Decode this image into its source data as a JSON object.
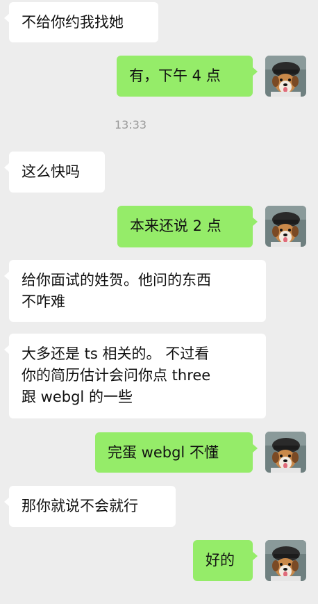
{
  "messages": [
    {
      "side": "left",
      "text": "不给你约我找她"
    },
    {
      "side": "right",
      "text": "有，下午 4 点"
    },
    {
      "side": "time",
      "text": "13:33"
    },
    {
      "side": "left",
      "text": "这么快吗"
    },
    {
      "side": "right",
      "text": "本来还说 2 点"
    },
    {
      "side": "left",
      "text": "给你面试的姓贺。他问的东西\n不咋难"
    },
    {
      "side": "left",
      "text": "大多还是 ts 相关的。 不过看\n你的简历估计会问你点 three\n跟 webgl 的一些"
    },
    {
      "side": "right",
      "text": "完蛋 webgl 不懂"
    },
    {
      "side": "left",
      "text": "那你就说不会就行"
    },
    {
      "side": "right",
      "text": "好的"
    }
  ],
  "avatar": {
    "icon": "dog-wearing-beret-avatar-icon",
    "bg_color": "#6f8080",
    "hat_color": "#2a2a2a"
  },
  "colors": {
    "background": "#ededed",
    "bubble_self": "#95ec69",
    "bubble_other": "#ffffff",
    "timestamp": "#9a9a9a"
  }
}
